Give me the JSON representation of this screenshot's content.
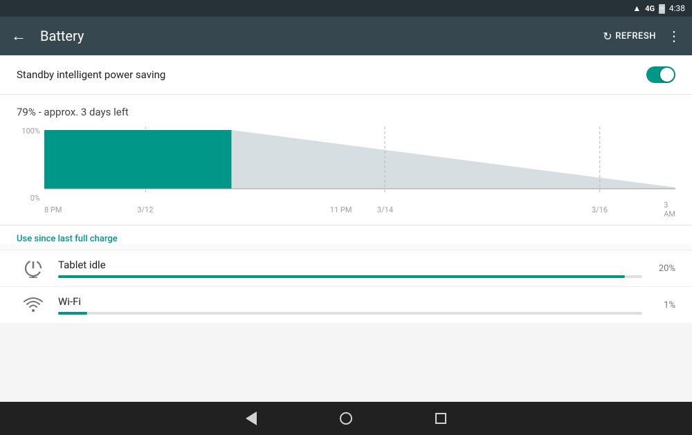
{
  "statusBar": {
    "network": "4G",
    "time": "4:38"
  },
  "topBar": {
    "title": "Battery",
    "backLabel": "←",
    "refreshLabel": "REFRESH",
    "moreLabel": "⋮"
  },
  "standby": {
    "label": "Standby intelligent power saving",
    "enabled": true
  },
  "batteryLevel": {
    "text": "79% - approx. 3 days left"
  },
  "chart": {
    "yLabels": [
      "100%",
      "0%"
    ],
    "xLabels": [
      {
        "label": "8 PM",
        "pct": 0
      },
      {
        "label": "3/12",
        "pct": 16
      },
      {
        "label": "11 PM",
        "pct": 47
      },
      {
        "label": "3/14",
        "pct": 54
      },
      {
        "label": "3 AM",
        "pct": 100
      },
      {
        "label": "3/16",
        "pct": 88
      }
    ]
  },
  "useSince": {
    "label": "Use since last full charge"
  },
  "usageItems": [
    {
      "name": "Tablet idle",
      "percent": "20%",
      "barWidth": 97,
      "iconType": "power"
    },
    {
      "name": "Wi-Fi",
      "percent": "1%",
      "barWidth": 5,
      "iconType": "wifi"
    }
  ]
}
